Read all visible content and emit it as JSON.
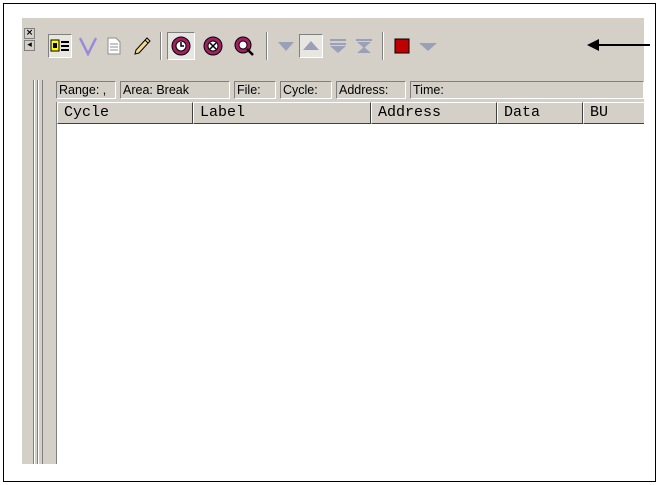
{
  "window": {
    "sys_buttons": [
      {
        "glyph": "×",
        "icon": "close-icon"
      },
      {
        "glyph": "◂",
        "icon": "collapse-icon"
      }
    ]
  },
  "toolbar": {
    "buttons": [
      {
        "name": "memory-chip-icon",
        "color": "#ffff00"
      },
      {
        "name": "filter-v-icon",
        "color": "#9a8ad8"
      },
      {
        "name": "document-icon",
        "color": "#8e8e8e"
      },
      {
        "name": "pencil-icon",
        "color": "#000000"
      },
      {
        "name": "trace-record-icon",
        "color": "#a02060",
        "pressed": true
      },
      {
        "name": "trace-search-icon",
        "color": "#a02060"
      },
      {
        "name": "trace-search-next-icon",
        "color": "#a02060"
      },
      {
        "name": "arrow-down-icon",
        "color": "#9aa0b8"
      },
      {
        "name": "arrow-up-icon",
        "color": "#9aa0b8",
        "pressed": true
      },
      {
        "name": "arrow-down-double-icon",
        "color": "#9aa0b8"
      },
      {
        "name": "arrow-bottom-icon",
        "color": "#9aa0b8"
      },
      {
        "name": "stop-icon",
        "color": "#c00000"
      },
      {
        "name": "dropdown-arrow-icon",
        "color": "#9aa0b8"
      }
    ]
  },
  "status": {
    "range": "Range: ,",
    "area": "Area: Break",
    "file": "File:",
    "cycle": "Cycle:",
    "address": "Address:",
    "time": "Time:"
  },
  "columns": [
    "Cycle",
    "Label",
    "Address",
    "Data",
    "BU"
  ]
}
